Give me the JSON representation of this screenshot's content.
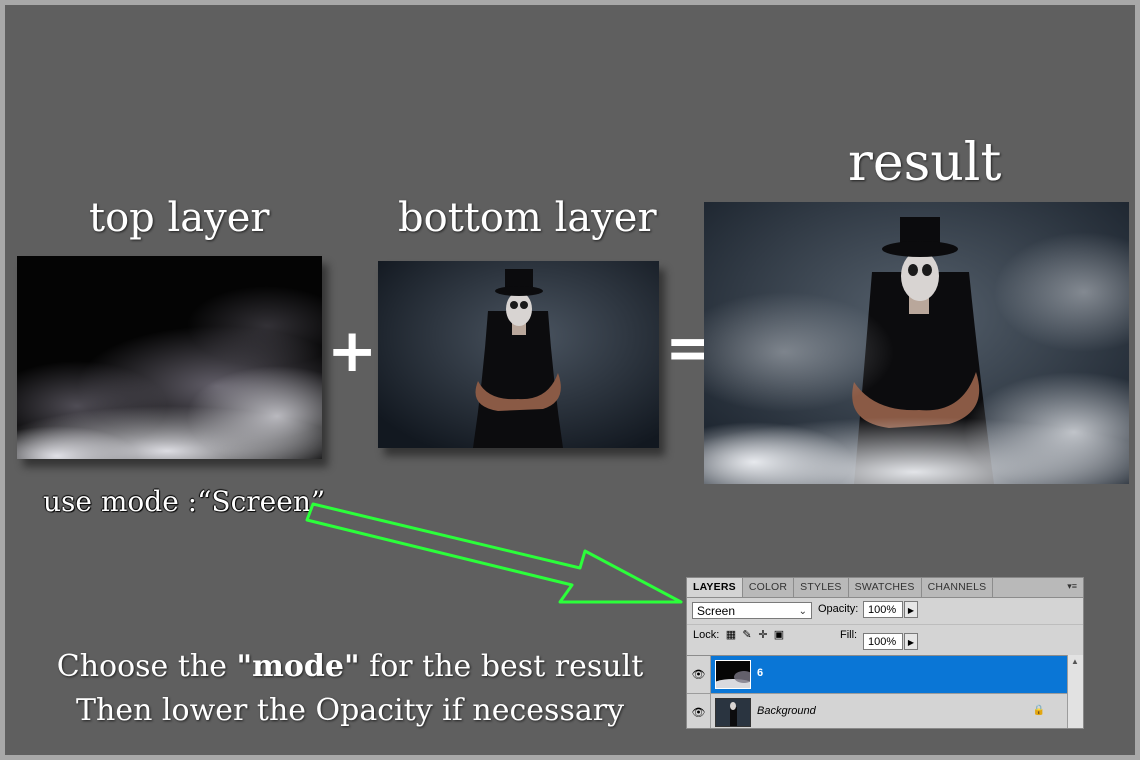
{
  "headings": {
    "top_layer": "top layer",
    "bottom_layer": "bottom layer",
    "result": "result"
  },
  "operators": {
    "plus": "+",
    "equals": "="
  },
  "hint": "use mode :“Screen”",
  "instructions": {
    "line1_prefix": "Choose the ",
    "line1_bold": "\"mode\"",
    "line1_suffix": " for the best result",
    "line2": "Then lower the Opacity if necessary"
  },
  "layers_panel": {
    "tabs": [
      "LAYERS",
      "COLOR",
      "STYLES",
      "SWATCHES",
      "CHANNELS"
    ],
    "active_tab": "LAYERS",
    "menu_icon": "▾≡",
    "blend_mode": "Screen",
    "opacity_label": "Opacity:",
    "opacity_value": "100%",
    "lock_label": "Lock:",
    "fill_label": "Fill:",
    "fill_value": "100%",
    "layers": [
      {
        "name": "6",
        "selected": true
      },
      {
        "name": "Background",
        "selected": false,
        "locked": true
      }
    ]
  },
  "colors": {
    "canvas": "#5f5f5f",
    "frame": "#a8a8a8",
    "arrow": "#2bff3a",
    "selected_layer": "#0a76d6"
  },
  "icons": [
    "eye-icon",
    "lock-icon",
    "chevron-down-icon",
    "stepper-arrow-icon",
    "panel-menu-icon"
  ]
}
